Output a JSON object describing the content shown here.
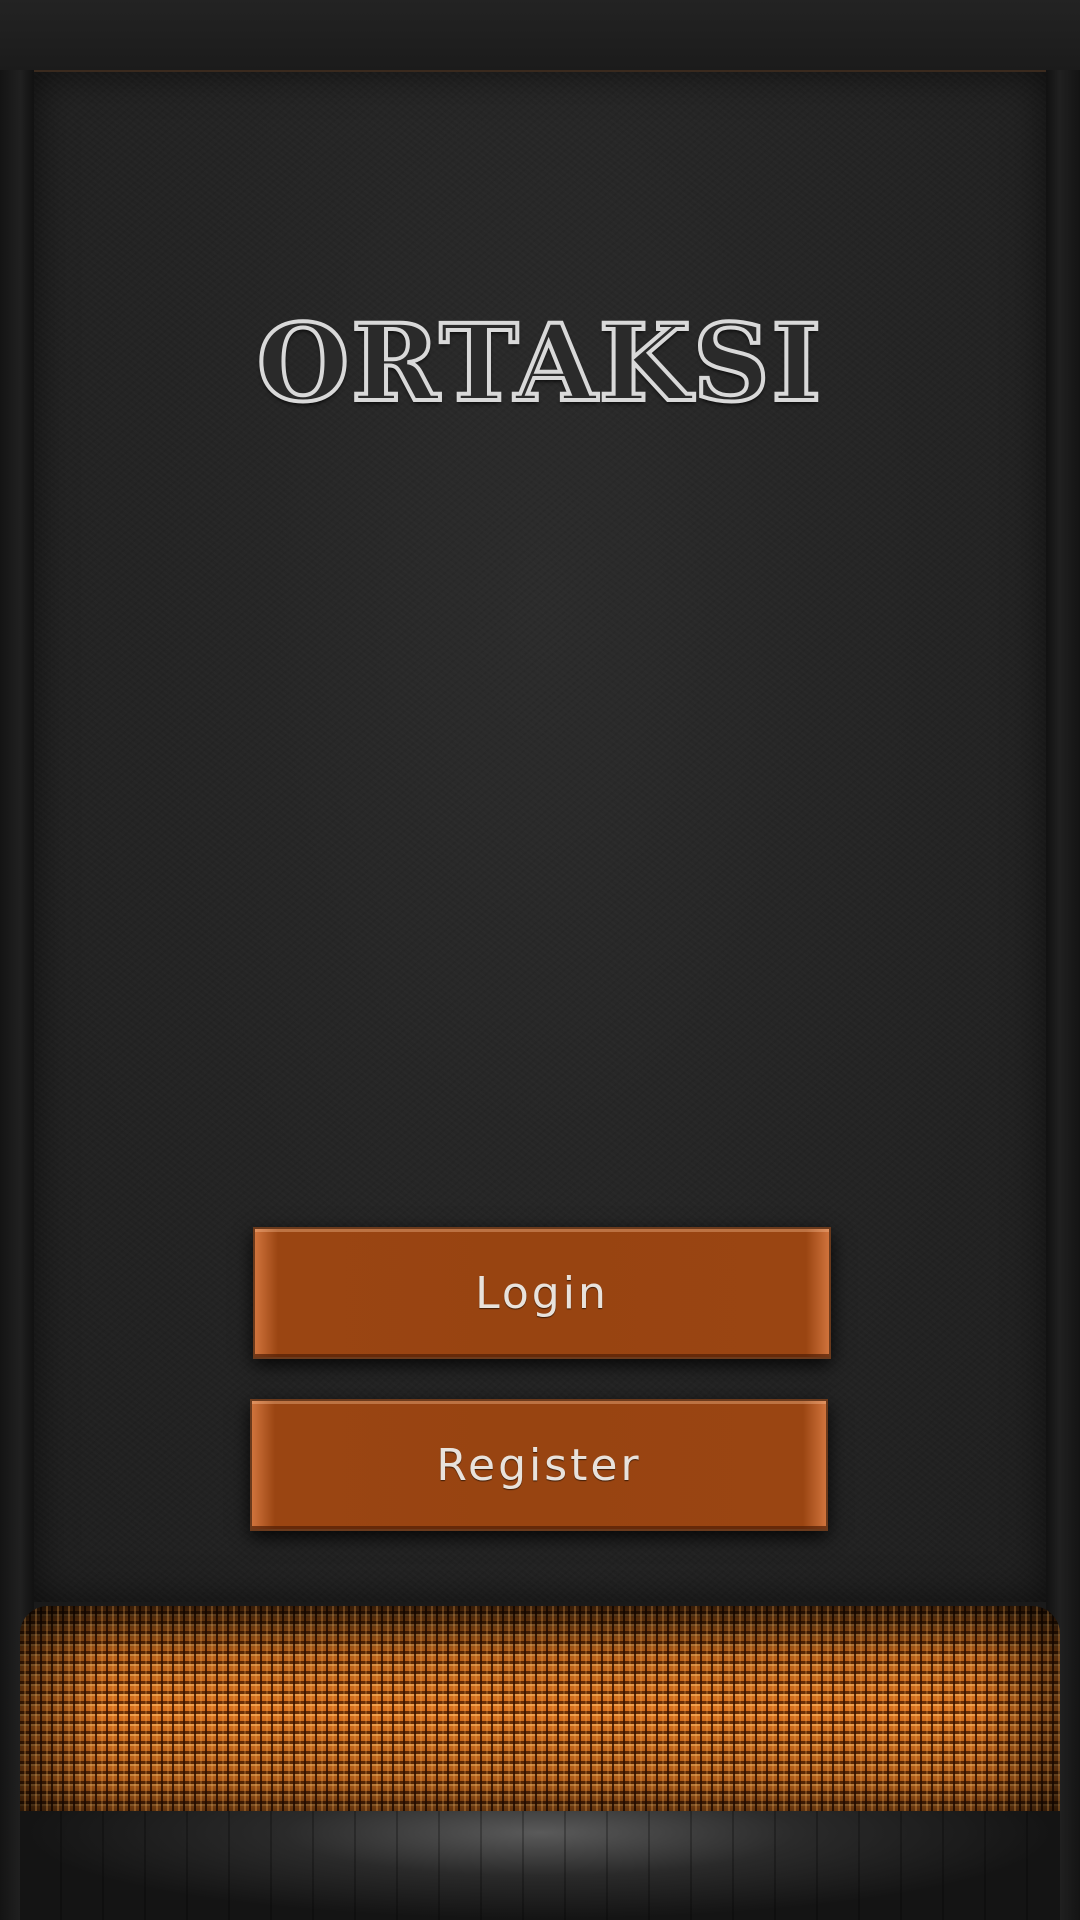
{
  "app": {
    "title": "ORTAKSI"
  },
  "actions": {
    "login_label": "Login",
    "register_label": "Register"
  },
  "colors": {
    "button": "#984411",
    "background": "#262626",
    "grille": "#d7711f",
    "title_outline": "#d9d9d9"
  }
}
